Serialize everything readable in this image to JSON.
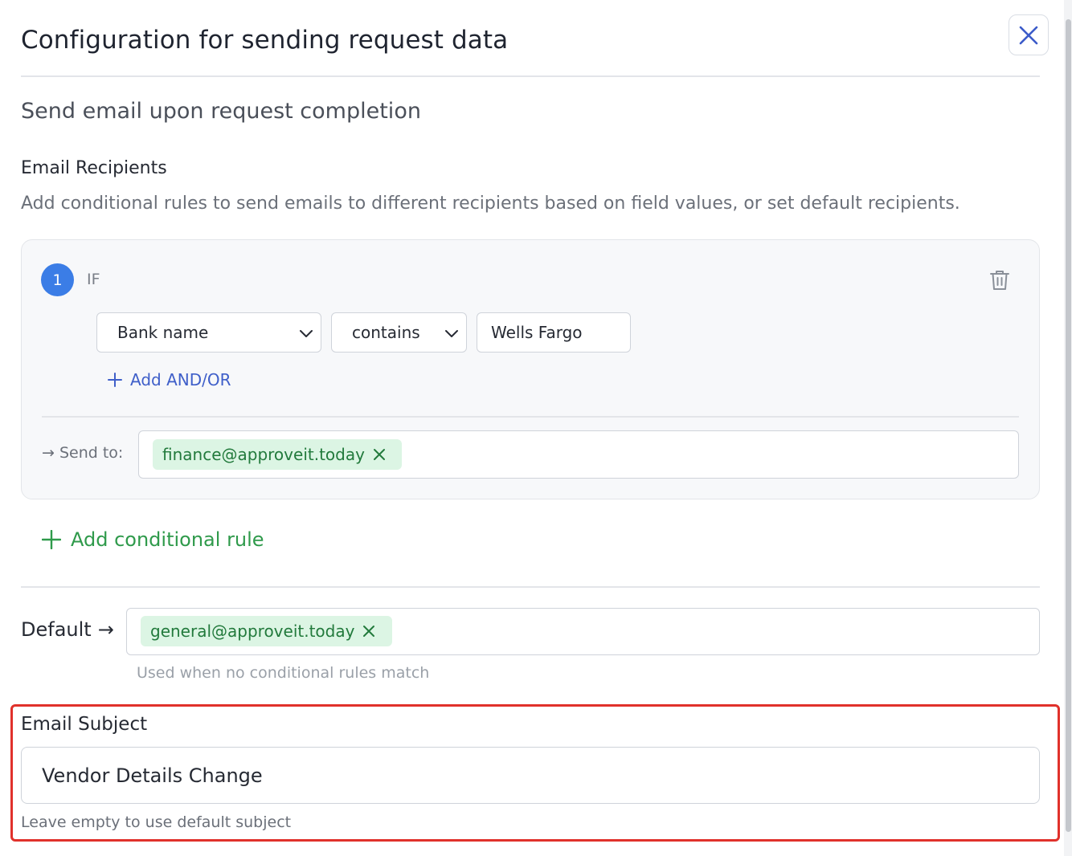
{
  "header": {
    "title": "Configuration for sending request data",
    "close_icon": "close-icon"
  },
  "section": {
    "heading": "Send email upon request completion"
  },
  "recipients": {
    "heading": "Email Recipients",
    "description": "Add conditional rules to send emails to different recipients based on field values, or set default recipients."
  },
  "rule": {
    "number": "1",
    "if_label": "IF",
    "field_value": "Bank name",
    "operator_value": "contains",
    "value": "Wells Fargo",
    "add_andor_label": "Add AND/OR",
    "send_to_label": "→ Send to:",
    "send_to_emails": [
      "finance@approveit.today"
    ]
  },
  "add_rule_label": "Add conditional rule",
  "default": {
    "label": "Default",
    "arrow": "→",
    "emails": [
      "general@approveit.today"
    ],
    "hint": "Used when no conditional rules match"
  },
  "subject": {
    "heading": "Email Subject",
    "value": "Vendor Details Change",
    "hint": "Leave empty to use default subject"
  },
  "colors": {
    "accent_blue": "#3b7de6",
    "link_blue": "#3f5fc9",
    "chip_bg": "#dcf5e4",
    "chip_text": "#227a3c",
    "add_rule_green": "#2f9a4b",
    "highlight_red": "#e0312b"
  }
}
